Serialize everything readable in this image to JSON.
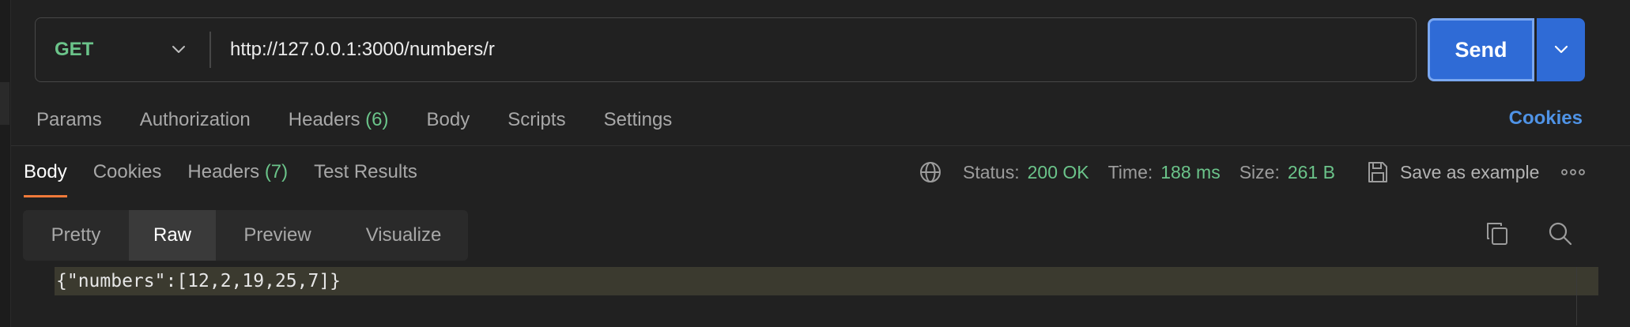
{
  "request": {
    "method": "GET",
    "url": "http://127.0.0.1:3000/numbers/r",
    "send_label": "Send"
  },
  "request_tabs": [
    {
      "label": "Params"
    },
    {
      "label": "Authorization"
    },
    {
      "label": "Headers",
      "count": "(6)"
    },
    {
      "label": "Body"
    },
    {
      "label": "Scripts"
    },
    {
      "label": "Settings"
    }
  ],
  "cookies_link": "Cookies",
  "response_tabs": [
    {
      "label": "Body",
      "active": true
    },
    {
      "label": "Cookies"
    },
    {
      "label": "Headers",
      "count": "(7)"
    },
    {
      "label": "Test Results"
    }
  ],
  "status": {
    "status_label": "Status:",
    "status_value": "200 OK",
    "time_label": "Time:",
    "time_value": "188 ms",
    "size_label": "Size:",
    "size_value": "261 B",
    "save_label": "Save as example"
  },
  "format_options": [
    {
      "label": "Pretty"
    },
    {
      "label": "Raw",
      "selected": true
    },
    {
      "label": "Preview"
    },
    {
      "label": "Visualize"
    }
  ],
  "response_body": "{\"numbers\":[12,2,19,25,7]}",
  "colors": {
    "accent_blue": "#2f6bd6",
    "status_green": "#6bc48a",
    "active_tab_underline": "#f07a3a",
    "link_blue": "#4f93e6"
  },
  "icons": {
    "method_dropdown": "chevron-down-icon",
    "send_dropdown": "chevron-down-icon",
    "network": "globe-icon",
    "save": "save-icon",
    "more": "more-horizontal-icon",
    "copy": "copy-icon",
    "search": "search-icon"
  }
}
